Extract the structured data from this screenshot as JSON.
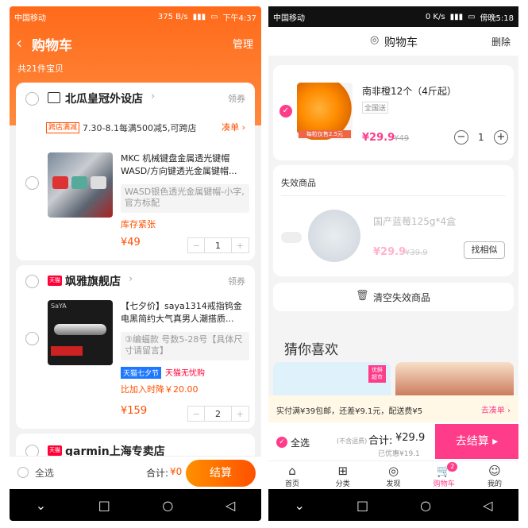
{
  "left": {
    "status": {
      "carrier": "中国移动",
      "speed": "375 B/s",
      "time": "下午4:37"
    },
    "header": {
      "title": "购物车",
      "manage": "管理",
      "count": "共21件宝贝"
    },
    "shops": [
      {
        "name": "北瓜皇冠外设店",
        "coupon": "领券",
        "promo_tag": "跨店满减",
        "promo_text": "7.30-8.1每满500减5,可跨店",
        "promo_link": "凑单",
        "item": {
          "title": "MKC 机械键盘金属透光键帽WASD/方向键透光金属键帽...",
          "sku": "WASD银色透光金属键帽-小字,官方标配",
          "stock": "库存紧张",
          "price": "¥49",
          "qty": "1"
        }
      },
      {
        "name": "飒雅旗舰店",
        "coupon": "领券",
        "logo_label": "天猫",
        "item": {
          "title": "【七夕价】saya1314戒指钨金电黑简约大气真男人潮搭质...",
          "sku": "③编蝠款 号数5-28号【具体尺寸请留言】",
          "badge1": "天猫七夕节",
          "badge2": "天猫无忧购",
          "drop": "比加入时降￥20.00",
          "price": "¥159",
          "qty": "2",
          "thumb_brand": "SaYA"
        }
      },
      {
        "name": "garmin上海专卖店",
        "logo_label": "天猫"
      }
    ],
    "footer": {
      "select_all": "全选",
      "total_label": "合计:",
      "total": "¥0",
      "checkout": "结算"
    }
  },
  "right": {
    "status": {
      "carrier": "中国移动",
      "speed": "0 K/s",
      "time": "傍晚5:18"
    },
    "header": {
      "title": "购物车",
      "delete": "删除"
    },
    "item": {
      "title": "南非橙12个（4斤起）",
      "tag": "全国送",
      "thumb_label": "每粒仅售2.5元",
      "price": "¥29.9",
      "orig": "¥49",
      "qty": "1"
    },
    "invalid": {
      "section": "失效商品",
      "title": "国产蓝莓125g*4盒",
      "price": "¥29.9",
      "orig": "¥39.9",
      "similar": "找相似",
      "clear": "清空失效商品"
    },
    "guess": {
      "title": "猜你喜欢",
      "badge": "优鲜超市"
    },
    "shipping": {
      "text": "实付满¥39包邮，还差¥9.1元，配送费¥5",
      "link": "去凑单"
    },
    "footer": {
      "select_all": "全选",
      "excl": "(不含运费)",
      "total_label": "合计:",
      "total": "¥29.9",
      "saved": "已优惠¥19.1",
      "checkout": "去结算"
    },
    "tabs": [
      {
        "label": "首页",
        "icon": "home-icon"
      },
      {
        "label": "分类",
        "icon": "category-icon"
      },
      {
        "label": "发现",
        "icon": "discover-icon"
      },
      {
        "label": "购物车",
        "icon": "cart-icon",
        "badge": "2"
      },
      {
        "label": "我的",
        "icon": "profile-icon"
      }
    ]
  },
  "colors": {
    "taobao_orange": "#ff5000",
    "price_red": "#ff4400",
    "app_pink": "#ff3c8a"
  }
}
